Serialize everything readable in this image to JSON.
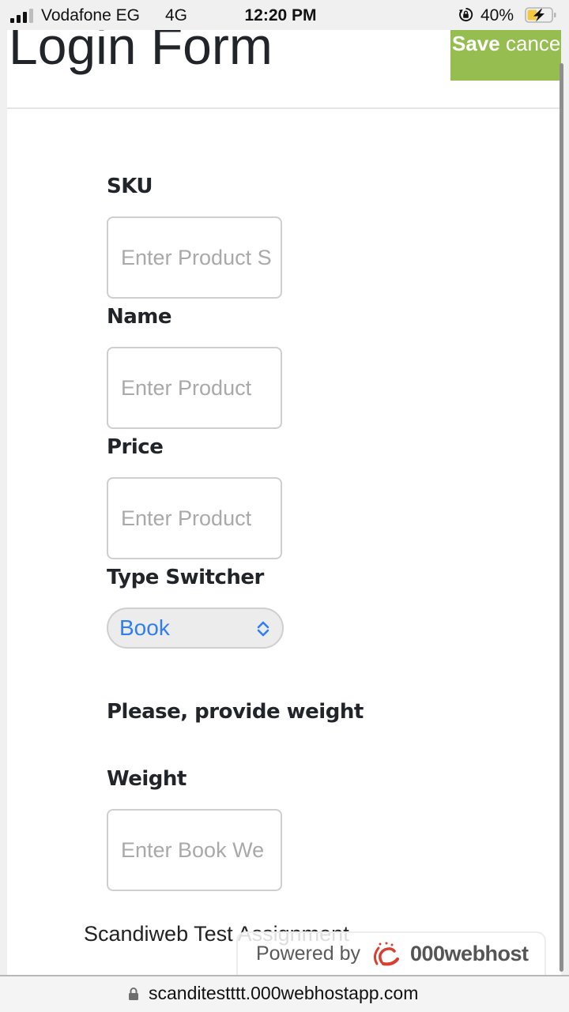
{
  "status_bar": {
    "signal_bars_active": 3,
    "signal_bars_total": 4,
    "carrier": "Vodafone EG",
    "network": "4G",
    "time": "12:20 PM",
    "battery_percent_label": "40%",
    "battery_level": 0.4,
    "charging": true,
    "icons": [
      "signal-icon",
      "orientation-lock-icon",
      "battery-charging-icon"
    ]
  },
  "page": {
    "title": "Login Form",
    "actions": {
      "save_label": "Save",
      "cancel_label": "cancel"
    },
    "form": {
      "sku": {
        "label": "SKU",
        "value": "",
        "placeholder": "Enter Product S"
      },
      "name": {
        "label": "Name",
        "value": "",
        "placeholder": "Enter Product"
      },
      "price": {
        "label": "Price",
        "value": "",
        "placeholder": "Enter Product"
      },
      "type_switcher": {
        "label": "Type Switcher",
        "selected": "Book"
      },
      "note": "Please, provide weight",
      "weight": {
        "label": "Weight",
        "value": "",
        "placeholder": "Enter Book We"
      }
    },
    "footer": {
      "text": "Scandiweb Test Assignment"
    },
    "powered_badge": {
      "prefix": "Powered by",
      "brand": "000webhost",
      "brand_color": "#d7402f"
    }
  },
  "browser": {
    "url": "scanditestttt.000webhostapp.com",
    "secure": true
  },
  "colors": {
    "accent_green": "#95bd50",
    "select_text_blue": "#2f7ef5",
    "label_text": "#212529",
    "placeholder": "#a9a9a9"
  }
}
